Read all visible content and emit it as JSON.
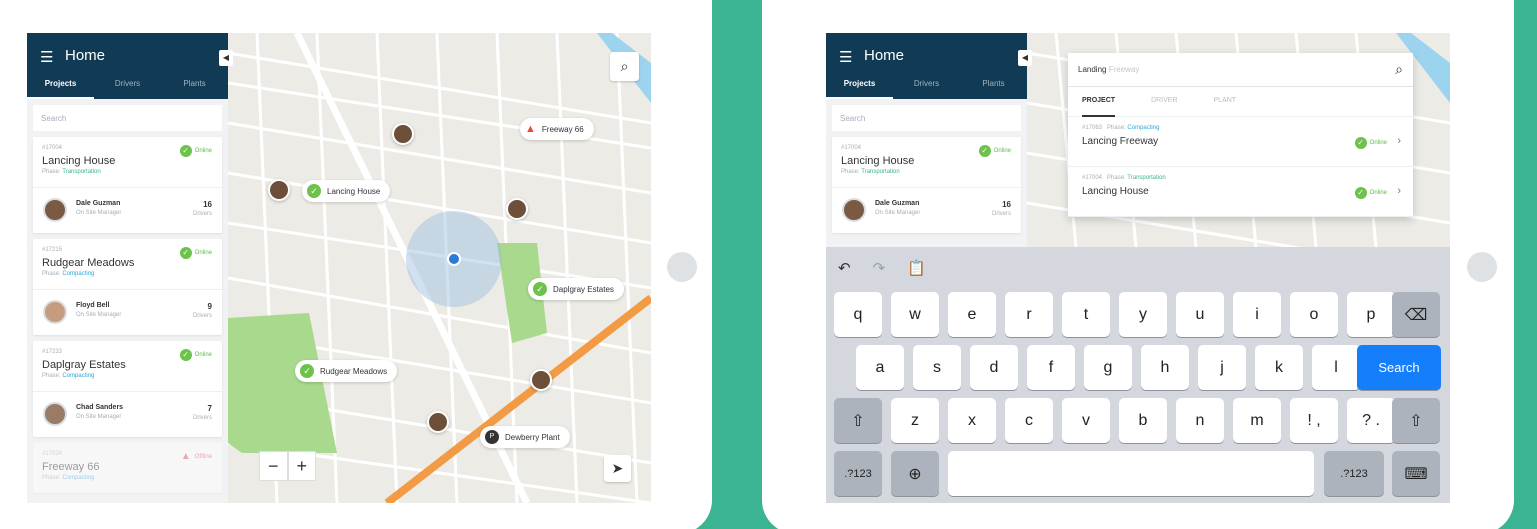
{
  "colors": {
    "background": "#3bb493",
    "header": "#113a54",
    "online": "#6cc24a",
    "offline": "#e05253",
    "search_key": "#157efb"
  },
  "left_app": {
    "header": {
      "menu_icon": "hamburger-icon",
      "title": "Home",
      "collapse_icon": "chevron-left-icon"
    },
    "tabs": [
      "Projects",
      "Drivers",
      "Plants"
    ],
    "search_placeholder": "Search",
    "projects": [
      {
        "code": "#17004",
        "name": "Lancing House",
        "phase_label": "Phase:",
        "phase": "Transportation",
        "status": "Online",
        "driver": "Dale Guzman",
        "role": "On Site Manager",
        "drivers_count": "16",
        "drivers_label": "Drivers"
      },
      {
        "code": "#17215",
        "name": "Rudgear Meadows",
        "phase_label": "Phase:",
        "phase": "Compacting",
        "status": "Online",
        "driver": "Floyd Bell",
        "role": "On Site Manager",
        "drivers_count": "9",
        "drivers_label": "Drivers"
      },
      {
        "code": "#17233",
        "name": "Daplgray Estates",
        "phase_label": "Phase:",
        "phase": "Compacting",
        "status": "Online",
        "driver": "Chad Sanders",
        "role": "On Site Manager",
        "drivers_count": "7",
        "drivers_label": "Drivers"
      },
      {
        "code": "#17024",
        "name": "Freeway 66",
        "phase_label": "Phase:",
        "phase": "Compacting",
        "status": "Offline"
      }
    ],
    "map": {
      "search_icon": "search-icon",
      "zoom_out": "−",
      "zoom_in": "+",
      "locate_icon": "navigation-arrow-icon",
      "pins": {
        "freeway": "Freeway 66",
        "lancing": "Lancing House",
        "daplgray": "Daplgray Estates",
        "rudgear": "Rudgear Meadows",
        "dewberry": "Dewberry Plant"
      }
    }
  },
  "right_app": {
    "header": {
      "title": "Home"
    },
    "tabs": [
      "Projects",
      "Drivers",
      "Plants"
    ],
    "search_placeholder": "Search",
    "card": {
      "code": "#17004",
      "name": "Lancing House",
      "phase_label": "Phase:",
      "phase": "Transportation",
      "status": "Online",
      "driver": "Dale Guzman",
      "role": "On Site Manager",
      "drivers_count": "16",
      "drivers_label": "Drivers"
    },
    "search": {
      "typed": "Landing",
      "suggestion": "Freeway",
      "icon": "search-icon"
    },
    "result_tabs": [
      "PROJECT",
      "DRIVER",
      "PLANT"
    ],
    "results": [
      {
        "code": "#17063",
        "phase_label": "Phase:",
        "phase": "Compacting",
        "name": "Lancing Freeway",
        "status": "Online"
      },
      {
        "code": "#17004",
        "phase_label": "Phase:",
        "phase": "Transportation",
        "name": "Lancing House",
        "status": "Online"
      }
    ],
    "keyboard": {
      "tools": [
        "↶",
        "↷",
        "📋"
      ],
      "row1": [
        "q",
        "w",
        "e",
        "r",
        "t",
        "y",
        "u",
        "i",
        "o",
        "p"
      ],
      "row2": [
        "a",
        "s",
        "d",
        "f",
        "g",
        "h",
        "j",
        "k",
        "l"
      ],
      "row3": [
        "z",
        "x",
        "c",
        "v",
        "b",
        "n",
        "m",
        "!\n,",
        "?\n."
      ],
      "search_key": "Search",
      "numbers_key": ".?123",
      "backspace_icon": "backspace-icon",
      "shift_icon": "shift-icon",
      "globe_icon": "globe-icon",
      "keyboard_icon": "keyboard-hide-icon"
    }
  }
}
